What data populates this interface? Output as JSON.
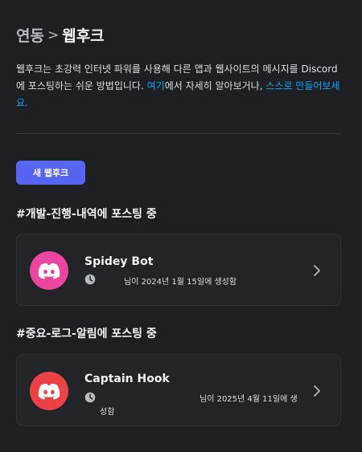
{
  "header": {
    "breadcrumb_parent": "연동",
    "breadcrumb_separator": ">",
    "title": "웹후크"
  },
  "description": {
    "text_before_link": "웹후크는 초강력 인터넷 파워를 사용해 다른 앱과 웹사이트의 메시지를 Discord에 포스팅하는 쉬운 방법입니다. ",
    "link1": "여기",
    "text_middle": "에서 자세히 알아보거나, ",
    "link2": "스스로 만들어보세요."
  },
  "new_webhook_button": "새 웹후크",
  "colors": {
    "accent": "#5865f2",
    "link": "#00a8fc",
    "avatar_pink": "#eb459f",
    "avatar_red": "#ed4245"
  },
  "sections": [
    {
      "title": "#개발-진행-내역에 포스팅 중",
      "webhook": {
        "name": "Spidey Bot",
        "created_line1": "님이 2024년 1월 15일에 생성함",
        "created_line2": "",
        "avatar_icon": "discord-logo-icon"
      }
    },
    {
      "title": "#중요-로그-알림에 포스팅 중",
      "webhook": {
        "name": "Captain Hook",
        "created_line1": "님이 2025년 4월 11일에 생",
        "created_line2": "성함",
        "avatar_icon": "discord-logo-icon"
      }
    }
  ]
}
